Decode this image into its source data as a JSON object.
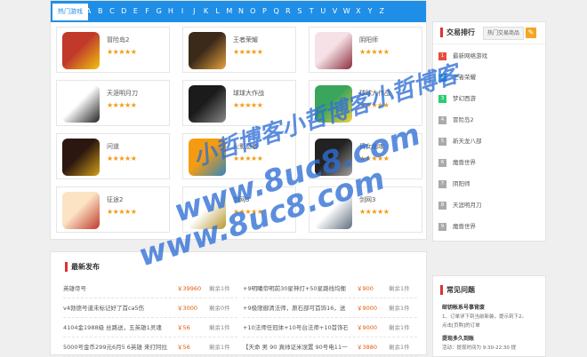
{
  "games_panel": {
    "hot_tab": "热门游戏",
    "letters": [
      "A",
      "B",
      "C",
      "D",
      "E",
      "F",
      "G",
      "H",
      "I",
      "J",
      "K",
      "L",
      "M",
      "N",
      "O",
      "P",
      "Q",
      "R",
      "S",
      "T",
      "U",
      "V",
      "W",
      "X",
      "Y",
      "Z"
    ],
    "games": [
      {
        "name": "冒险岛2",
        "stars": "★★★★★",
        "colors": [
          "#c0392b",
          "#f1c40f"
        ]
      },
      {
        "name": "王者荣耀",
        "stars": "★★★★★",
        "colors": [
          "#3b2a1a",
          "#e6a23c"
        ]
      },
      {
        "name": "阴阳师",
        "stars": "★★★★★",
        "colors": [
          "#f5e1e6",
          "#8b2c3b"
        ]
      },
      {
        "name": "天涯明月刀",
        "stars": "★★★★★",
        "colors": [
          "#ffffff",
          "#222222"
        ]
      },
      {
        "name": "球球大作战",
        "stars": "★★★★★",
        "colors": [
          "#1b1b1b",
          "#888888"
        ]
      },
      {
        "name": "球球大作战",
        "stars": "★★★★★",
        "colors": [
          "#3aa55b",
          "#f4d03f"
        ]
      },
      {
        "name": "问道",
        "stars": "★★★★★",
        "colors": [
          "#2b1710",
          "#d4a017"
        ]
      },
      {
        "name": "火影忍者",
        "stars": "★★★★★",
        "colors": [
          "#f39c12",
          "#2e86c1"
        ]
      },
      {
        "name": "倩女幽魂",
        "stars": "★★★★★",
        "colors": [
          "#222222",
          "#a0a0a0"
        ]
      },
      {
        "name": "征途2",
        "stars": "★★★★★",
        "colors": [
          "#fbe3c4",
          "#c0392b"
        ]
      },
      {
        "name": "剑网3",
        "stars": "★★★★★",
        "colors": [
          "#ffffff",
          "#b8962e"
        ]
      },
      {
        "name": "剑网3",
        "stars": "★★★★★",
        "colors": [
          "#ffffff",
          "#5d6d7e"
        ]
      }
    ]
  },
  "ranking": {
    "title": "交易排行",
    "tab": "热门交易商品",
    "search_icon": "✎",
    "items": [
      {
        "num": "1",
        "label": "最新网络游戏",
        "color": "#e74c3c"
      },
      {
        "num": "2",
        "label": "王者荣耀",
        "color": "#3498db"
      },
      {
        "num": "3",
        "label": "梦幻西游",
        "color": "#2ecc71"
      },
      {
        "num": "4",
        "label": "冒险岛2",
        "color": "#aaaaaa"
      },
      {
        "num": "5",
        "label": "新天龙八部",
        "color": "#aaaaaa"
      },
      {
        "num": "6",
        "label": "魔兽世界",
        "color": "#aaaaaa"
      },
      {
        "num": "7",
        "label": "阴阳师",
        "color": "#aaaaaa"
      },
      {
        "num": "8",
        "label": "天涯明月刀",
        "color": "#aaaaaa"
      },
      {
        "num": "9",
        "label": "魔兽世界",
        "color": "#aaaaaa"
      }
    ]
  },
  "latest": {
    "title": "最新发布",
    "rows": [
      {
        "title": "英雄帝号",
        "price": "￥39960",
        "stock": "剩余1件"
      },
      {
        "title": "+9明曦帝明前30星神灯+50星路线均衡",
        "price": "￥900",
        "stock": "剩余1件"
      },
      {
        "title": "v4勃德号道未标记好了首ca5伤",
        "price": "￥3000",
        "stock": "剩余0件"
      },
      {
        "title": "+9极限御清法师，原石部可首饰16，送",
        "price": "￥9000",
        "stock": "剩余1件"
      },
      {
        "title": "4104金1988级 丝路送，五英雄1灵魂",
        "price": "￥56",
        "stock": "剩余1件"
      },
      {
        "title": "+10法师任冠体+10号台法师+10首饰石",
        "price": "￥9000",
        "stock": "剩余1件"
      },
      {
        "title": "5000号金币299元6月5 6英雄 来打阿拉 王",
        "price": "￥56",
        "stock": "剩余1件"
      },
      {
        "title": "【天命 男 90 真帅证米误置 90号电11一",
        "price": "￥3880",
        "stock": "剩余1件"
      }
    ]
  },
  "faq": {
    "title": "常见问题",
    "items": [
      {
        "q": "邮钥帐系号事背废",
        "a": "1、订单详下到当前新装，提示到下2。"
      },
      {
        "q": "",
        "a": "点击[页购]的订单"
      },
      {
        "q": "提现多久到账",
        "a": "活动：提现时间为 9:30-22:30 提"
      }
    ]
  },
  "watermark": {
    "cn_line": "小哲博客小哲博客小哲博客",
    "url_line": "www.8uc8.com"
  }
}
